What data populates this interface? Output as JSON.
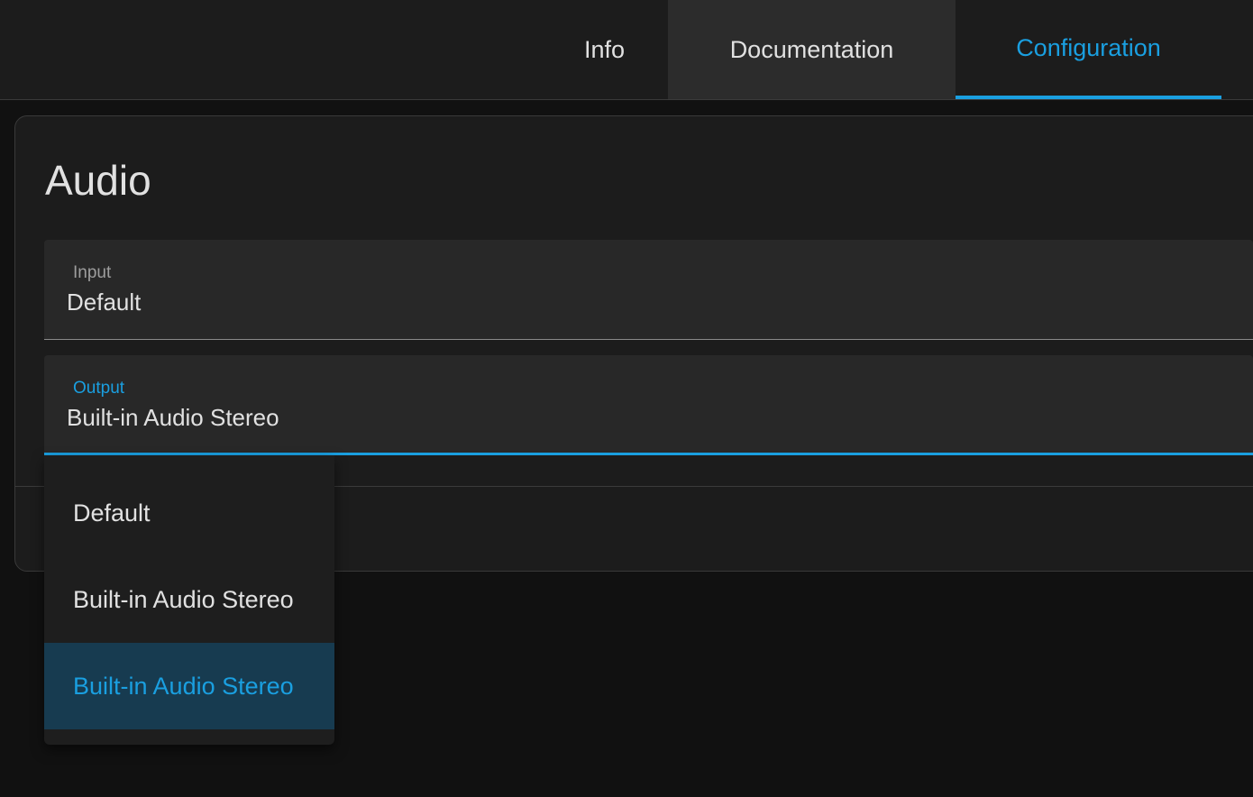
{
  "tabs": [
    {
      "label": "Info"
    },
    {
      "label": "Documentation"
    },
    {
      "label": "Configuration"
    }
  ],
  "active_tab": "Configuration",
  "card": {
    "title": "Audio"
  },
  "fields": {
    "input": {
      "label": "Input",
      "value": "Default"
    },
    "output": {
      "label": "Output",
      "value": "Built-in Audio Stereo"
    }
  },
  "dropdown": {
    "options": [
      {
        "label": "Default"
      },
      {
        "label": "Built-in Audio Stereo"
      },
      {
        "label": "Built-in Audio Stereo"
      }
    ],
    "selected_index": 2
  },
  "colors": {
    "accent": "#1a9fe0",
    "selected_bg": "#173b50",
    "background": "#111111",
    "surface": "#1c1c1c"
  }
}
